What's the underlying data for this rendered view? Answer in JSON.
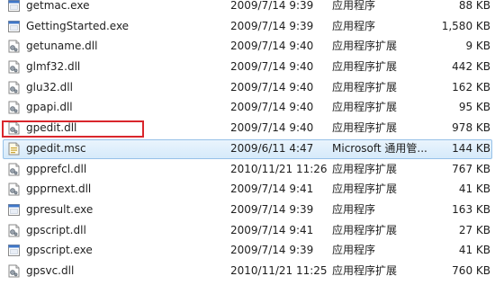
{
  "files": [
    {
      "name": "getmac.exe",
      "date": "2009/7/14 9:39",
      "type": "应用程序",
      "size": "88 KB",
      "icon": "exe-icon"
    },
    {
      "name": "GettingStarted.exe",
      "date": "2009/7/14 9:39",
      "type": "应用程序",
      "size": "1,580 KB",
      "icon": "exe-icon"
    },
    {
      "name": "getuname.dll",
      "date": "2009/7/14 9:40",
      "type": "应用程序扩展",
      "size": "9 KB",
      "icon": "dll-icon"
    },
    {
      "name": "glmf32.dll",
      "date": "2009/7/14 9:40",
      "type": "应用程序扩展",
      "size": "442 KB",
      "icon": "dll-icon"
    },
    {
      "name": "glu32.dll",
      "date": "2009/7/14 9:40",
      "type": "应用程序扩展",
      "size": "162 KB",
      "icon": "dll-icon"
    },
    {
      "name": "gpapi.dll",
      "date": "2009/7/14 9:40",
      "type": "应用程序扩展",
      "size": "95 KB",
      "icon": "dll-icon"
    },
    {
      "name": "gpedit.dll",
      "date": "2009/7/14 9:40",
      "type": "应用程序扩展",
      "size": "978 KB",
      "icon": "dll-icon"
    },
    {
      "name": "gpedit.msc",
      "date": "2009/6/11 4:47",
      "type": "Microsoft 通用管...",
      "size": "144 KB",
      "icon": "msc-icon",
      "selected": true
    },
    {
      "name": "gpprefcl.dll",
      "date": "2010/11/21 11:26",
      "type": "应用程序扩展",
      "size": "767 KB",
      "icon": "dll-icon"
    },
    {
      "name": "gpprnext.dll",
      "date": "2009/7/14 9:41",
      "type": "应用程序扩展",
      "size": "41 KB",
      "icon": "dll-icon"
    },
    {
      "name": "gpresult.exe",
      "date": "2009/7/14 9:39",
      "type": "应用程序",
      "size": "163 KB",
      "icon": "exe-icon"
    },
    {
      "name": "gpscript.dll",
      "date": "2009/7/14 9:41",
      "type": "应用程序扩展",
      "size": "27 KB",
      "icon": "dll-icon"
    },
    {
      "name": "gpscript.exe",
      "date": "2009/7/14 9:39",
      "type": "应用程序",
      "size": "41 KB",
      "icon": "exe-icon"
    },
    {
      "name": "gpsvc.dll",
      "date": "2010/11/21 11:25",
      "type": "应用程序扩展",
      "size": "760 KB",
      "icon": "dll-icon"
    }
  ],
  "highlight_color": "#d9262c",
  "selection_color": "#d6eafa"
}
